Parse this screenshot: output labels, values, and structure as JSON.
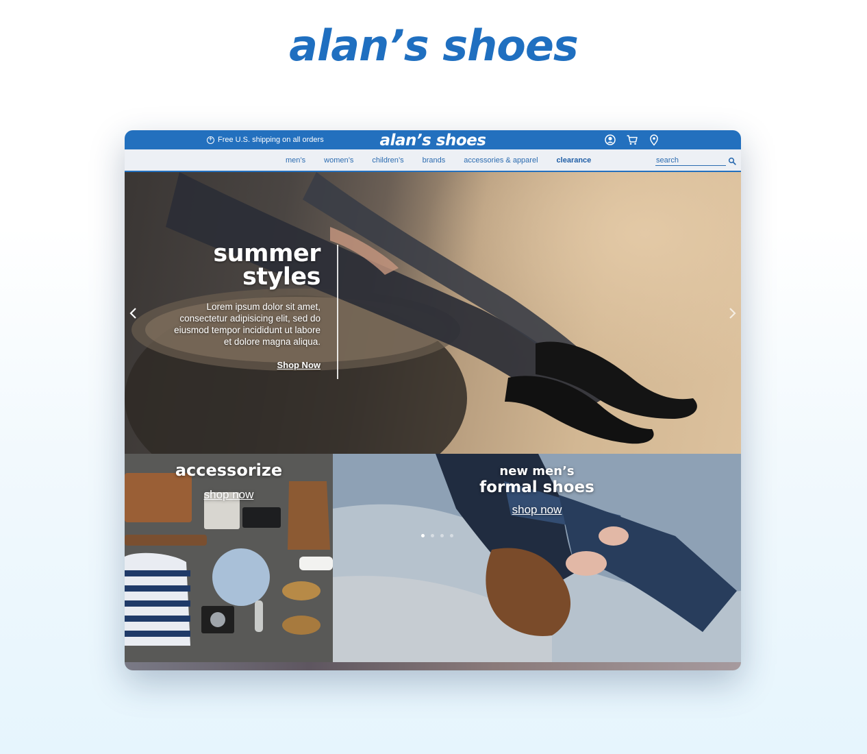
{
  "page": {
    "brand_logo": "alan’s shoes"
  },
  "topbar": {
    "shipping_text": "Free U.S. shipping on all orders",
    "logo": "alan’s shoes",
    "icons": [
      "user-icon",
      "cart-icon",
      "location-pin-icon"
    ],
    "brand_color": "#2370be"
  },
  "nav": {
    "items": [
      "men’s",
      "women’s",
      "children’s",
      "brands",
      "accessories & apparel",
      "clearance"
    ],
    "search_placeholder": "search"
  },
  "hero": {
    "title_line1": "summer",
    "title_line2": "styles",
    "body": "Lorem ipsum dolor sit amet, consectetur adipisicing elit, sed do eiusmod tempor incididunt ut labore et dolore magna aliqua.",
    "cta": "Shop Now",
    "slide_count": 4,
    "active_slide": 1
  },
  "tiles": {
    "left": {
      "title": "accessorize",
      "cta": "shop now"
    },
    "right": {
      "title_line1": "new men’s",
      "title_line2": "formal shoes",
      "cta": "shop now"
    }
  }
}
